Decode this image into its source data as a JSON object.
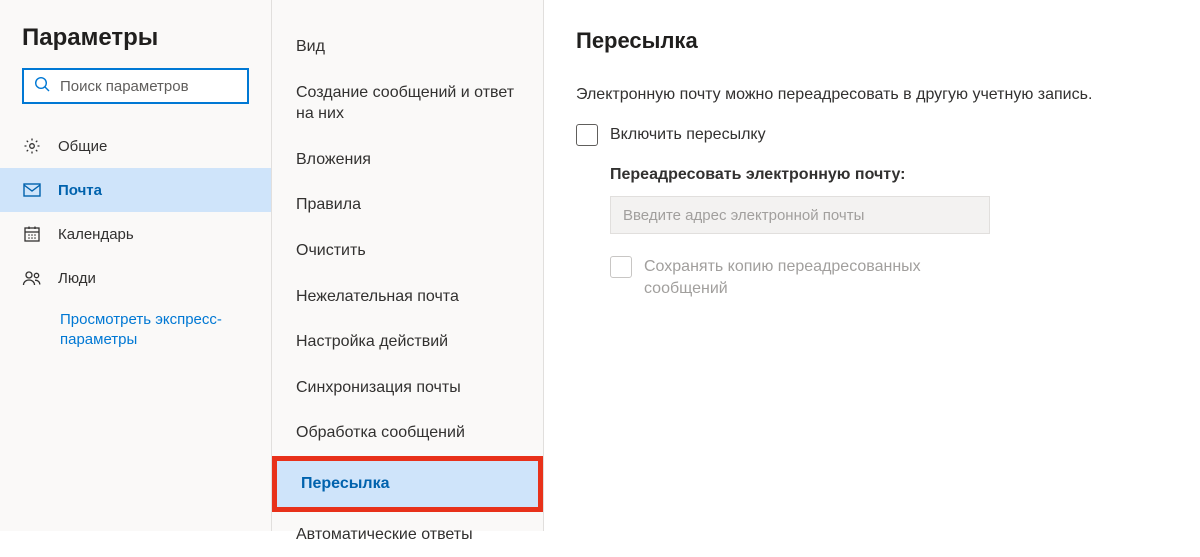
{
  "sidebar": {
    "title": "Параметры",
    "search_placeholder": "Поиск параметров",
    "items": [
      {
        "key": "general",
        "label": "Общие"
      },
      {
        "key": "mail",
        "label": "Почта"
      },
      {
        "key": "calendar",
        "label": "Календарь"
      },
      {
        "key": "people",
        "label": "Люди"
      }
    ],
    "quick_link": "Просмотреть экспресс-параметры"
  },
  "subnav": {
    "items": [
      "Вид",
      "Создание сообщений и ответ на них",
      "Вложения",
      "Правила",
      "Очистить",
      "Нежелательная почта",
      "Настройка действий",
      "Синхронизация почты",
      "Обработка сообщений",
      "Пересылка",
      "Автоматические ответы"
    ],
    "active_index": 9
  },
  "main": {
    "title": "Пересылка",
    "description": "Электронную почту можно переадресовать в другую учетную запись.",
    "enable_label": "Включить пересылку",
    "forward_label": "Переадресовать электронную почту:",
    "email_placeholder": "Введите адрес электронной почты",
    "keep_copy_label": "Сохранять копию переадресованных сообщений"
  }
}
